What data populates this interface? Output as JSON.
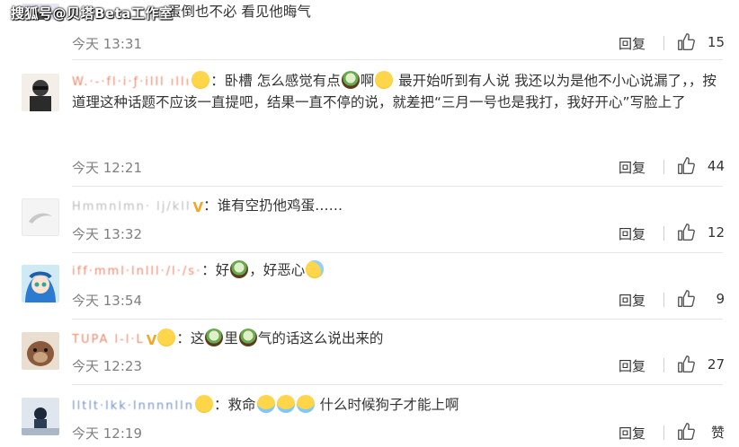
{
  "watermark": "搜狐号@贝塔Beta工作室",
  "comments": [
    {
      "username": "",
      "text": "蛋倒也不必 看见他晦气",
      "time": "今天 13:31",
      "reply": "回复",
      "likes": "15"
    },
    {
      "username": "W.·-·fl·i‧ƒ·illl ıllı",
      "text_a": "：卧槽 怎么感觉有点",
      "text_b": "啊",
      "text_c": " 最开始听到有人说 我还以为是他不小心说漏了，，按道理这种话题不应该一直提吧，结果一直不停的说，就差把“三月一号也是我打，我好开心”写脸上了",
      "time": "今天 12:21",
      "reply": "回复",
      "likes": "44"
    },
    {
      "username": "Hmmnlmn· lj/kll",
      "text": "：谁有空扔他鸡蛋……",
      "time": "今天 13:32",
      "reply": "回复",
      "likes": "12"
    },
    {
      "username": "iff·mml·lnlll·/l·/s·",
      "text_a": "：好",
      "text_b": "，好恶心",
      "time": "今天 13:54",
      "reply": "回复",
      "likes": "9"
    },
    {
      "username": "TUPA l-l·L",
      "text_a": "：这",
      "text_b": "里",
      "text_c": "气的话这么说出来的",
      "time": "今天 12:23",
      "reply": "回复",
      "likes": "27"
    },
    {
      "username": "lltlt·lkk·lnnnnlln",
      "text_a": "：救命",
      "text_b": " 什么时候狗子才能上啊",
      "time": "今天 12:19",
      "reply": "回复",
      "likes": "赞"
    }
  ],
  "colors": {
    "username": "#eb7350",
    "meta": "#808080",
    "separator": "#e6e6e6"
  }
}
